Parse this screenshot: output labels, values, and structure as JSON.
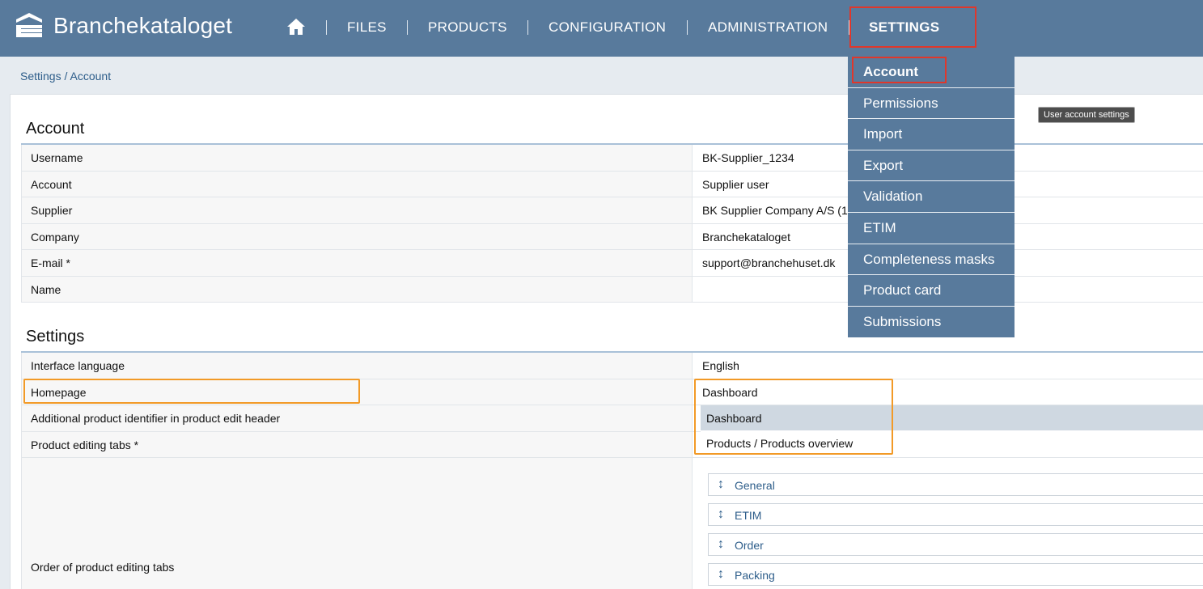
{
  "header": {
    "brand": "Branchekataloget",
    "nav": {
      "files": "FILES",
      "products": "PRODUCTS",
      "configuration": "CONFIGURATION",
      "administration": "ADMINISTRATION",
      "settings": "SETTINGS"
    }
  },
  "breadcrumb": {
    "root": "Settings",
    "sep": " / ",
    "current": "Account"
  },
  "settings_menu": {
    "items": [
      "Account",
      "Permissions",
      "Import",
      "Export",
      "Validation",
      "ETIM",
      "Completeness masks",
      "Product card",
      "Submissions"
    ]
  },
  "tooltip": "User account settings",
  "account": {
    "title": "Account",
    "rows": [
      {
        "label": "Username",
        "value": "BK-Supplier_1234"
      },
      {
        "label": "Account",
        "value": "Supplier user"
      },
      {
        "label": "Supplier",
        "value": "BK Supplier Company A/S (12"
      },
      {
        "label": "Company",
        "value": "Branchekataloget"
      },
      {
        "label": "E-mail *",
        "value": "support@branchehuset.dk"
      },
      {
        "label": "Name",
        "value": ""
      }
    ]
  },
  "settings": {
    "title": "Settings",
    "rows": [
      {
        "label": "Interface language",
        "value": "English"
      },
      {
        "label": "Homepage",
        "value": "Dashboard"
      },
      {
        "label": "Additional product identifier in product edit header",
        "value": ""
      },
      {
        "label": "Product editing tabs *",
        "value": ""
      },
      {
        "label": "Order of product editing tabs",
        "value": ""
      }
    ],
    "homepage_options": [
      "Dashboard",
      "Products / Products overview"
    ],
    "tab_order": [
      "General",
      "ETIM",
      "Order",
      "Packing"
    ]
  },
  "colors": {
    "header_bg": "#587a9c",
    "highlight_red": "#e0372b",
    "highlight_orange": "#f29a27",
    "link": "#2d5d8a"
  }
}
